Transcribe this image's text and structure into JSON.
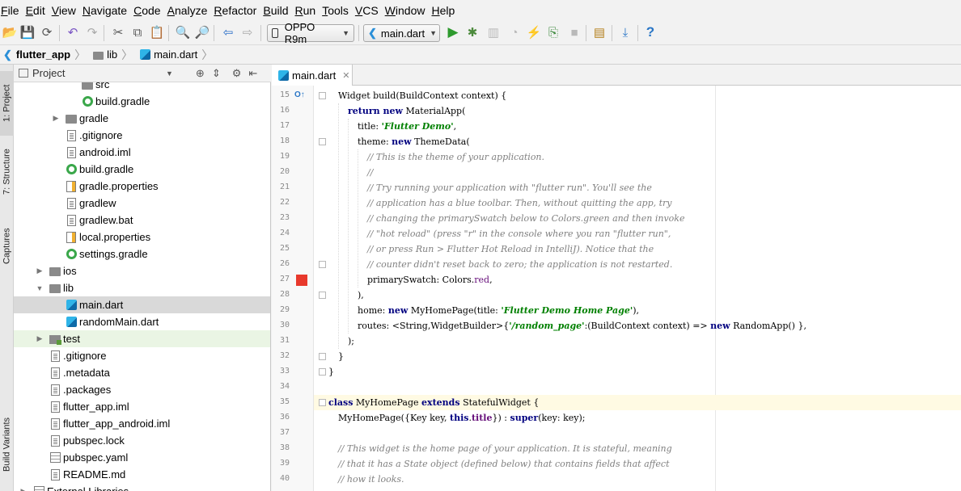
{
  "menu": [
    "File",
    "Edit",
    "View",
    "Navigate",
    "Code",
    "Analyze",
    "Refactor",
    "Build",
    "Run",
    "Tools",
    "VCS",
    "Window",
    "Help"
  ],
  "toolbar": {
    "device": "OPPO R9m",
    "run_config": "main.dart"
  },
  "breadcrumb": [
    "flutter_app",
    "lib",
    "main.dart"
  ],
  "side_tabs": [
    "1: Project",
    "7: Structure",
    "Captures",
    "Build Variants"
  ],
  "project_panel": {
    "title": "Project",
    "items": [
      {
        "label": "src",
        "icon": "folder",
        "indent": 4,
        "arrow": ""
      },
      {
        "label": "build.gradle",
        "icon": "gradle",
        "indent": 4,
        "arrow": ""
      },
      {
        "label": "gradle",
        "icon": "folder",
        "indent": 3,
        "arrow": "right"
      },
      {
        "label": ".gitignore",
        "icon": "file",
        "indent": 3,
        "arrow": ""
      },
      {
        "label": "android.iml",
        "icon": "file",
        "indent": 3,
        "arrow": ""
      },
      {
        "label": "build.gradle",
        "icon": "gradle",
        "indent": 3,
        "arrow": ""
      },
      {
        "label": "gradle.properties",
        "icon": "props",
        "indent": 3,
        "arrow": ""
      },
      {
        "label": "gradlew",
        "icon": "file",
        "indent": 3,
        "arrow": ""
      },
      {
        "label": "gradlew.bat",
        "icon": "file",
        "indent": 3,
        "arrow": ""
      },
      {
        "label": "local.properties",
        "icon": "props",
        "indent": 3,
        "arrow": ""
      },
      {
        "label": "settings.gradle",
        "icon": "gradle",
        "indent": 3,
        "arrow": ""
      },
      {
        "label": "ios",
        "icon": "folder",
        "indent": 2,
        "arrow": "right"
      },
      {
        "label": "lib",
        "icon": "folder",
        "indent": 2,
        "arrow": "down"
      },
      {
        "label": "main.dart",
        "icon": "dart",
        "indent": 3,
        "arrow": "",
        "selected": true
      },
      {
        "label": "randomMain.dart",
        "icon": "dart",
        "indent": 3,
        "arrow": ""
      },
      {
        "label": "test",
        "icon": "test",
        "indent": 2,
        "arrow": "right",
        "highlight": true
      },
      {
        "label": ".gitignore",
        "icon": "file",
        "indent": 2,
        "arrow": ""
      },
      {
        "label": ".metadata",
        "icon": "file",
        "indent": 2,
        "arrow": ""
      },
      {
        "label": ".packages",
        "icon": "file",
        "indent": 2,
        "arrow": ""
      },
      {
        "label": "flutter_app.iml",
        "icon": "file",
        "indent": 2,
        "arrow": ""
      },
      {
        "label": "flutter_app_android.iml",
        "icon": "file",
        "indent": 2,
        "arrow": ""
      },
      {
        "label": "pubspec.lock",
        "icon": "file",
        "indent": 2,
        "arrow": ""
      },
      {
        "label": "pubspec.yaml",
        "icon": "table",
        "indent": 2,
        "arrow": ""
      },
      {
        "label": "README.md",
        "icon": "file",
        "indent": 2,
        "arrow": ""
      },
      {
        "label": "External Libraries",
        "icon": "lib",
        "indent": 1,
        "arrow": "right"
      }
    ]
  },
  "editor": {
    "tab_label": "main.dart",
    "lines": [
      {
        "n": "15",
        "indent": 1,
        "html": "Widget build(BuildContext context) {"
      },
      {
        "n": "16",
        "indent": 2,
        "html": "<span class='kw'>return new</span> MaterialApp("
      },
      {
        "n": "17",
        "indent": 3,
        "html": "title: <span class='str'>'Flutter Demo'</span>,"
      },
      {
        "n": "18",
        "indent": 3,
        "html": "theme: <span class='kw'>new</span> ThemeData("
      },
      {
        "n": "19",
        "indent": 4,
        "html": "<span class='cm'>// This is the theme of your application.</span>"
      },
      {
        "n": "20",
        "indent": 4,
        "html": "<span class='cm'>//</span>"
      },
      {
        "n": "21",
        "indent": 4,
        "html": "<span class='cm'>// Try running your application with \"flutter run\". You'll see the</span>"
      },
      {
        "n": "22",
        "indent": 4,
        "html": "<span class='cm'>// application has a blue toolbar. Then, without quitting the app, try</span>"
      },
      {
        "n": "23",
        "indent": 4,
        "html": "<span class='cm'>// changing the primarySwatch below to Colors.green and then invoke</span>"
      },
      {
        "n": "24",
        "indent": 4,
        "html": "<span class='cm'>// \"hot reload\" (press \"r\" in the console where you ran \"flutter run\",</span>"
      },
      {
        "n": "25",
        "indent": 4,
        "html": "<span class='cm'>// or press Run &gt; Flutter Hot Reload in IntelliJ). Notice that the</span>"
      },
      {
        "n": "26",
        "indent": 4,
        "html": "<span class='cm'>// counter didn't reset back to zero; the application is not restarted.</span>"
      },
      {
        "n": "27",
        "indent": 4,
        "html": "primarySwatch: Colors.<span class='fld'>red</span>,"
      },
      {
        "n": "28",
        "indent": 3,
        "html": "),"
      },
      {
        "n": "29",
        "indent": 3,
        "html": "home: <span class='kw'>new</span> MyHomePage(title: <span class='str'>'Flutter Demo Home Page'</span>),"
      },
      {
        "n": "30",
        "indent": 3,
        "html": "routes: &lt;String,WidgetBuilder&gt;{<span class='str'>'/random_page'</span>:(BuildContext context) =&gt; <span class='kw'>new</span> RandomApp() },"
      },
      {
        "n": "31",
        "indent": 2,
        "html": ");"
      },
      {
        "n": "32",
        "indent": 1,
        "html": "}"
      },
      {
        "n": "33",
        "indent": 0,
        "html": "}"
      },
      {
        "n": "34",
        "indent": 0,
        "html": ""
      },
      {
        "n": "35",
        "indent": 0,
        "html": "<span class='kw'>class</span> MyHomePage <span class='kw'>extends</span> StatefulWidget {"
      },
      {
        "n": "36",
        "indent": 1,
        "html": "MyHomePage({Key key, <span class='kw'>this</span>.<span class='fld' style='font-weight:bold'>title</span>}) : <span class='kw'>super</span>(key: key);"
      },
      {
        "n": "37",
        "indent": 0,
        "html": ""
      },
      {
        "n": "38",
        "indent": 1,
        "html": "<span class='cm'>// This widget is the home page of your application. It is stateful, meaning</span>"
      },
      {
        "n": "39",
        "indent": 1,
        "html": "<span class='cm'>// that it has a State object (defined below) that contains fields that affect</span>"
      },
      {
        "n": "40",
        "indent": 1,
        "html": "<span class='cm'>// how it looks.</span>"
      }
    ]
  },
  "colors": {
    "breakpoint": "#e8392c",
    "selection": "#d9d9d9",
    "test_highlight": "#eaf5e4",
    "current_line": "#fffae3"
  }
}
